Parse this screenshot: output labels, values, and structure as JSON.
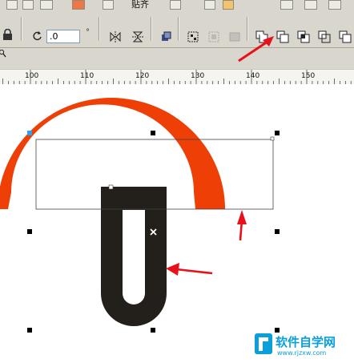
{
  "top_toolbar": {
    "label": "贴齐"
  },
  "property_bar": {
    "angle_value": ".0",
    "angle_unit": "°",
    "shaping_buttons": [
      "weld-button",
      "trim-button",
      "intersect-button",
      "simplify-button",
      "front-minus-back-button"
    ]
  },
  "ruler": {
    "ticks": [
      "100",
      "110",
      "120",
      "130",
      "140",
      "150"
    ]
  },
  "colors": {
    "toolbar_bg": "#d9d6ce",
    "orange_shape": "#ee3f06",
    "dark_shape": "#231f1b",
    "arrow": "#e8111a"
  },
  "watermark": {
    "brand": "软件自学网",
    "url": "www.rjzxw.com"
  }
}
